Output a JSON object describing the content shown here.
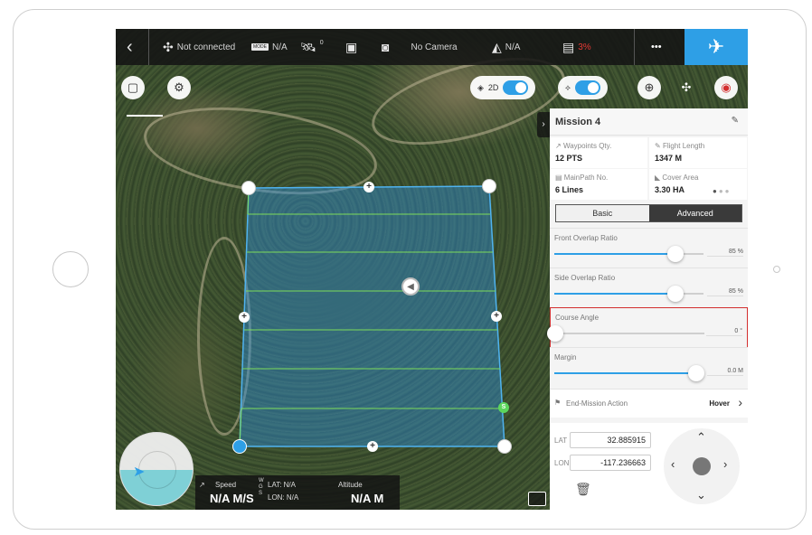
{
  "topbar": {
    "connection": "Not connected",
    "mode_chip": "MODE",
    "mode_value": "N/A",
    "gps_count": "0",
    "camera": "No Camera",
    "signal_value": "N/A",
    "battery": "3%",
    "more": "•••"
  },
  "map_controls": {
    "toggle_2d_label": "2D"
  },
  "mission": {
    "title": "Mission 4",
    "waypoints_label": "Waypoints Qty.",
    "waypoints_value": "12 PTS",
    "flight_length_label": "Flight Length",
    "flight_length_value": "1347 M",
    "mainpath_label": "MainPath No.",
    "mainpath_value": "6 Lines",
    "cover_area_label": "Cover Area",
    "cover_area_value": "3.30 HA",
    "tabs": [
      "Basic",
      "Advanced"
    ],
    "sliders": [
      {
        "label": "Front Overlap Ratio",
        "value": "85 %",
        "fraction": 0.81
      },
      {
        "label": "Side Overlap Ratio",
        "value": "85 %",
        "fraction": 0.81
      },
      {
        "label": "Course Angle",
        "value": "0 °",
        "fraction": 0.0
      },
      {
        "label": "Margin",
        "value": "0.0 M",
        "fraction": 0.95
      }
    ],
    "end_action_label": "End-Mission Action",
    "end_action_value": "Hover"
  },
  "coords": {
    "lat_label": "LAT",
    "lat_value": "32.885915",
    "lon_label": "LON",
    "lon_value": "-117.236663"
  },
  "status": {
    "speed_label": "Speed",
    "speed_value": "N/A M/S",
    "lat_text": "LAT: N/A",
    "lon_text": "LON: N/A",
    "wgs": "W G S",
    "altitude_label": "Altitude",
    "altitude_value": "N/A M"
  },
  "waypoint_marker": "S",
  "icons": {
    "back": "chevron-left-icon",
    "drone": "drone-icon",
    "save": "save-icon",
    "settings": "gear-icon",
    "fly": "airplane-icon"
  },
  "colors": {
    "accent": "#2e9fe6",
    "mission_fill": "#2e8fd8",
    "grid_lines": "#7ddc5a",
    "highlight": "#d32f2f"
  }
}
